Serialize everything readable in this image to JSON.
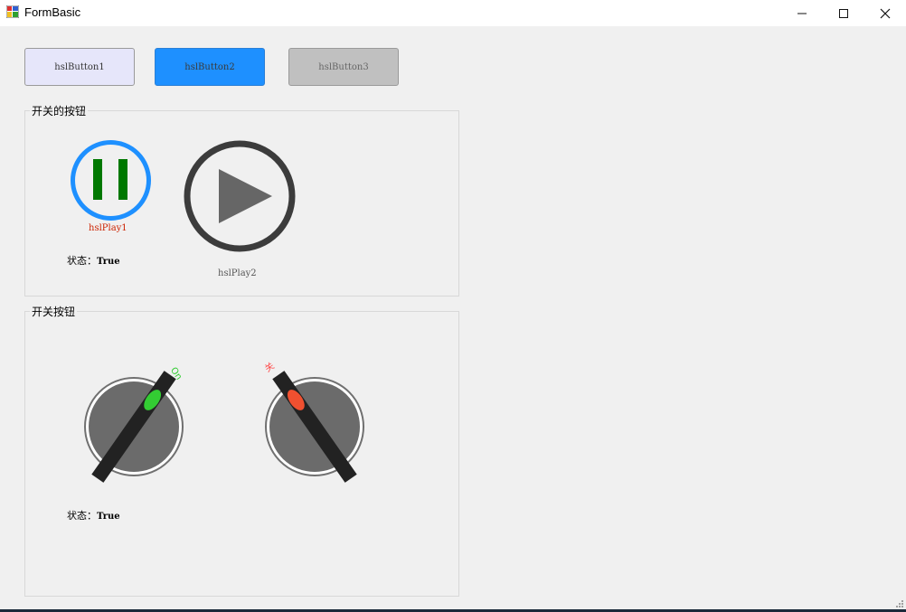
{
  "window": {
    "title": "FormBasic",
    "minimize": "—",
    "maximize": "☐",
    "close": "✕"
  },
  "buttons": [
    {
      "label": "hslButton1"
    },
    {
      "label": "hslButton2"
    },
    {
      "label": "hslButton3"
    }
  ],
  "group_play": {
    "title": "开关的按钮",
    "play1": {
      "label": "hslPlay1",
      "state": "pause",
      "ring_color": "#1e90ff",
      "bar_color": "#007800",
      "label_color": "#cc2200"
    },
    "play2": {
      "label": "hslPlay2",
      "state": "play",
      "ring_color": "#3c3c3c",
      "triangle_color": "#666666",
      "label_color": "#555555"
    },
    "status_prefix": "状态：",
    "status_value": "True"
  },
  "group_switch": {
    "title": "开关按钮",
    "switch1": {
      "caption": "On",
      "caption_color": "#33cc33",
      "light_color": "#33cc33",
      "is_on": true
    },
    "switch2": {
      "caption": "关",
      "caption_color": "#ff4444",
      "light_color": "#f05030",
      "is_on": false
    },
    "status_prefix": "状态：",
    "status_value": "True"
  }
}
